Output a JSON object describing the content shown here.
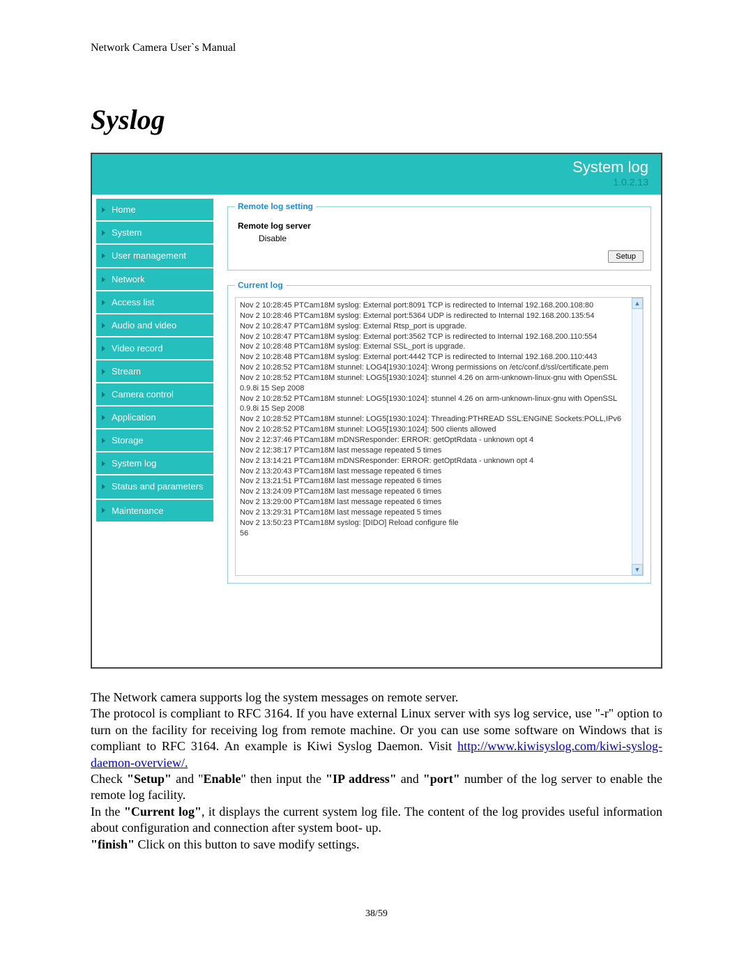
{
  "doc": {
    "header": "Network Camera User`s Manual",
    "title": "Syslog",
    "page_num": "38/59"
  },
  "screenshot": {
    "header": {
      "title": "System log",
      "version": "1.0.2.13"
    },
    "nav": [
      "Home",
      "System",
      "User management",
      "Network",
      "Access list",
      "Audio and video",
      "Video record",
      "Stream",
      "Camera control",
      "Application",
      "Storage",
      "System log",
      "Status and parameters",
      "Maintenance"
    ],
    "remote_log": {
      "legend": "Remote log setting",
      "server_label": "Remote log server",
      "server_value": "Disable",
      "setup_btn": "Setup"
    },
    "current_log": {
      "legend": "Current log",
      "lines": [
        "Nov 2 10:28:45 PTCam18M syslog: External port:8091 TCP is redirected to Internal 192.168.200.108:80",
        "Nov 2 10:28:46 PTCam18M syslog: External port:5364 UDP is redirected to Internal 192.168.200.135:54",
        "Nov 2 10:28:47 PTCam18M syslog: External Rtsp_port is upgrade.",
        "Nov 2 10:28:47 PTCam18M syslog: External port:3562 TCP is redirected to Internal 192.168.200.110:554",
        "Nov 2 10:28:48 PTCam18M syslog: External SSL_port is upgrade.",
        "Nov 2 10:28:48 PTCam18M syslog: External port:4442 TCP is redirected to Internal 192.168.200.110:443",
        "Nov 2 10:28:52 PTCam18M stunnel: LOG4[1930:1024]: Wrong permissions on /etc/conf.d/ssl/certificate.pem",
        "Nov 2 10:28:52 PTCam18M stunnel: LOG5[1930:1024]: stunnel 4.26 on arm-unknown-linux-gnu with OpenSSL 0.9.8i 15 Sep 2008",
        "Nov 2 10:28:52 PTCam18M stunnel: LOG5[1930:1024]: stunnel 4.26 on arm-unknown-linux-gnu with OpenSSL 0.9.8i 15 Sep 2008",
        "Nov 2 10:28:52 PTCam18M stunnel: LOG5[1930:1024]: Threading:PTHREAD SSL:ENGINE Sockets:POLL,IPv6",
        "Nov 2 10:28:52 PTCam18M stunnel: LOG5[1930:1024]: 500 clients allowed",
        "Nov 2 12:37:46 PTCam18M mDNSResponder: ERROR: getOptRdata - unknown opt 4",
        "Nov 2 12:38:17 PTCam18M last message repeated 5 times",
        "Nov 2 13:14:21 PTCam18M mDNSResponder: ERROR: getOptRdata - unknown opt 4",
        "Nov 2 13:20:43 PTCam18M last message repeated 6 times",
        "Nov 2 13:21:51 PTCam18M last message repeated 6 times",
        "Nov 2 13:24:09 PTCam18M last message repeated 6 times",
        "Nov 2 13:29:00 PTCam18M last message repeated 6 times",
        "Nov 2 13:29:31 PTCam18M last message repeated 5 times",
        "Nov 2 13:50:23 PTCam18M syslog: [DIDO] Reload configure file",
        "56"
      ]
    }
  },
  "body": {
    "p1": "The Network camera supports log the system messages on remote server.",
    "p2_a": "The protocol is compliant to RFC 3164. If you have external Linux server with sys log service, use \"-r\" option to turn on the facility for receiving log from remote machine. Or you can use some software on Windows that is compliant to RFC 3164. An example is Kiwi Syslog Daemon. Visit ",
    "p2_link": "http://www.kiwisyslog.com/kiwi-syslog-daemon-overview/.",
    "p3_a": "Check ",
    "p3_b": "\"Setup\"",
    "p3_c": " and \"",
    "p3_d": "Enable",
    "p3_e": "\" then input the ",
    "p3_f": "\"IP address\"",
    "p3_g": " and ",
    "p3_h": "\"port\"",
    "p3_i": " number of the log server to enable the remote log facility.",
    "p4_a": "In the ",
    "p4_b": "\"Current log\"",
    "p4_c": ", it displays the current system log file. The content of the log provides useful information about configuration and connection after system boot- up.",
    "p5_a": "\"finish\"",
    "p5_b": " Click on this button to save modify settings."
  }
}
